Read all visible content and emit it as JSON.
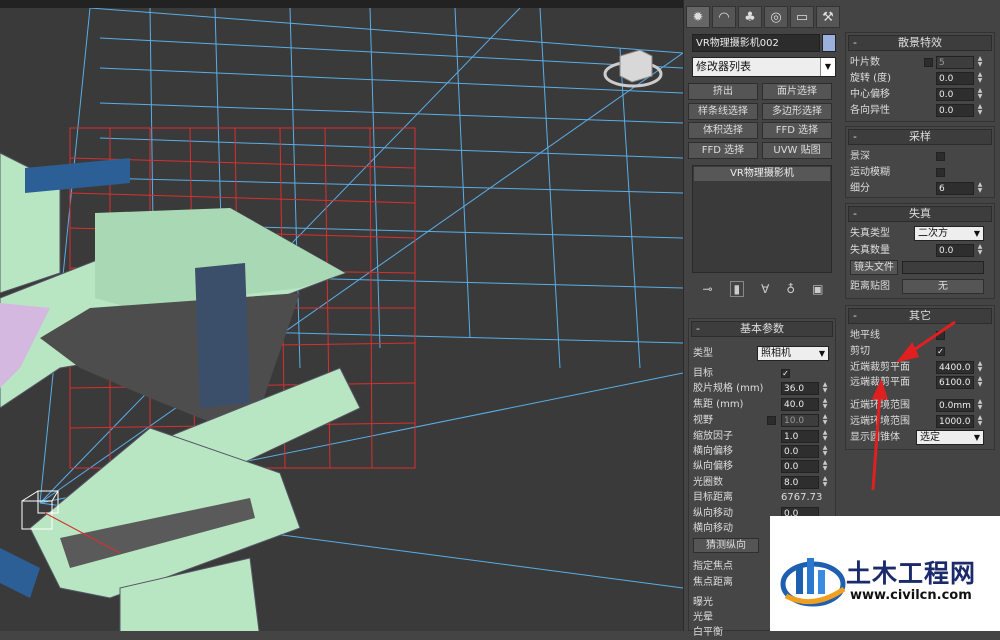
{
  "panel": {
    "tabs": [
      "create-icon",
      "modify-icon",
      "hierarchy-icon",
      "motion-icon",
      "display-icon",
      "utilities-icon"
    ],
    "object_name": "VR物理摄影机002",
    "modifier_list": "修改器列表",
    "modifier_buttons": [
      "挤出",
      "面片选择",
      "样条线选择",
      "多边形选择",
      "体积选择",
      "FFD 选择",
      "FFD 选择",
      "UVW 贴图"
    ],
    "stack_item": "VR物理摄影机"
  },
  "basic": {
    "title": "基本参数",
    "type_label": "类型",
    "type_value": "照相机",
    "target_label": "目标",
    "film_gate_label": "胶片规格 (mm)",
    "film_gate_value": "36.0",
    "focal_label": "焦距 (mm)",
    "focal_value": "40.0",
    "fov_label": "视野",
    "fov_value": "10.0",
    "zoom_label": "缩放因子",
    "zoom_value": "1.0",
    "hshift_label": "横向偏移",
    "hshift_value": "0.0",
    "vshift_label": "纵向偏移",
    "vshift_value": "0.0",
    "fnumber_label": "光圈数",
    "fnumber_value": "8.0",
    "target_dist_label": "目标距离",
    "target_dist_value": "6767.73",
    "vtilt_label": "纵向移动",
    "vtilt_value": "0.0",
    "htilt_label": "横向移动",
    "guess_btn": "猜测纵向",
    "focus_label": "指定焦点",
    "focus_dist_label": "焦点距离",
    "exposure_label": "曝光",
    "vignette_label": "光晕",
    "wb_label": "白平衡"
  },
  "bokeh": {
    "title": "散景特效",
    "blades_label": "叶片数",
    "blades_value": "5",
    "rotation_label": "旋转 (度)",
    "rotation_value": "0.0",
    "center_label": "中心偏移",
    "center_value": "0.0",
    "aniso_label": "各向异性",
    "aniso_value": "0.0"
  },
  "sampling": {
    "title": "采样",
    "dof_label": "景深",
    "motion_label": "运动模糊",
    "subdiv_label": "细分",
    "subdiv_value": "6"
  },
  "distortion": {
    "title": "失真",
    "type_label": "失真类型",
    "type_value": "二次方",
    "amount_label": "失真数量",
    "amount_value": "0.0",
    "lens_label": "镜头文件",
    "map_label": "距离贴图",
    "map_value": "无"
  },
  "misc": {
    "title": "其它",
    "horizon_label": "地平线",
    "clip_label": "剪切",
    "near_clip_label": "近端裁剪平面",
    "near_clip_value": "4400.0",
    "far_clip_label": "远端裁剪平面",
    "far_clip_value": "6100.0",
    "near_env_label": "近端环境范围",
    "near_env_value": "0.0mm",
    "far_env_label": "远端环境范围",
    "far_env_value": "1000.0",
    "cone_label": "显示圆锥体",
    "cone_value": "选定"
  },
  "watermark": {
    "name": "土木工程网",
    "url": "www.civilcn.com"
  },
  "colors": {
    "frustum_blue": "#5aaee8",
    "grid_red": "#d83030",
    "building_green": "#b9e6c2",
    "accent_blue": "#2c5f95",
    "arrow_red": "#e02020"
  }
}
